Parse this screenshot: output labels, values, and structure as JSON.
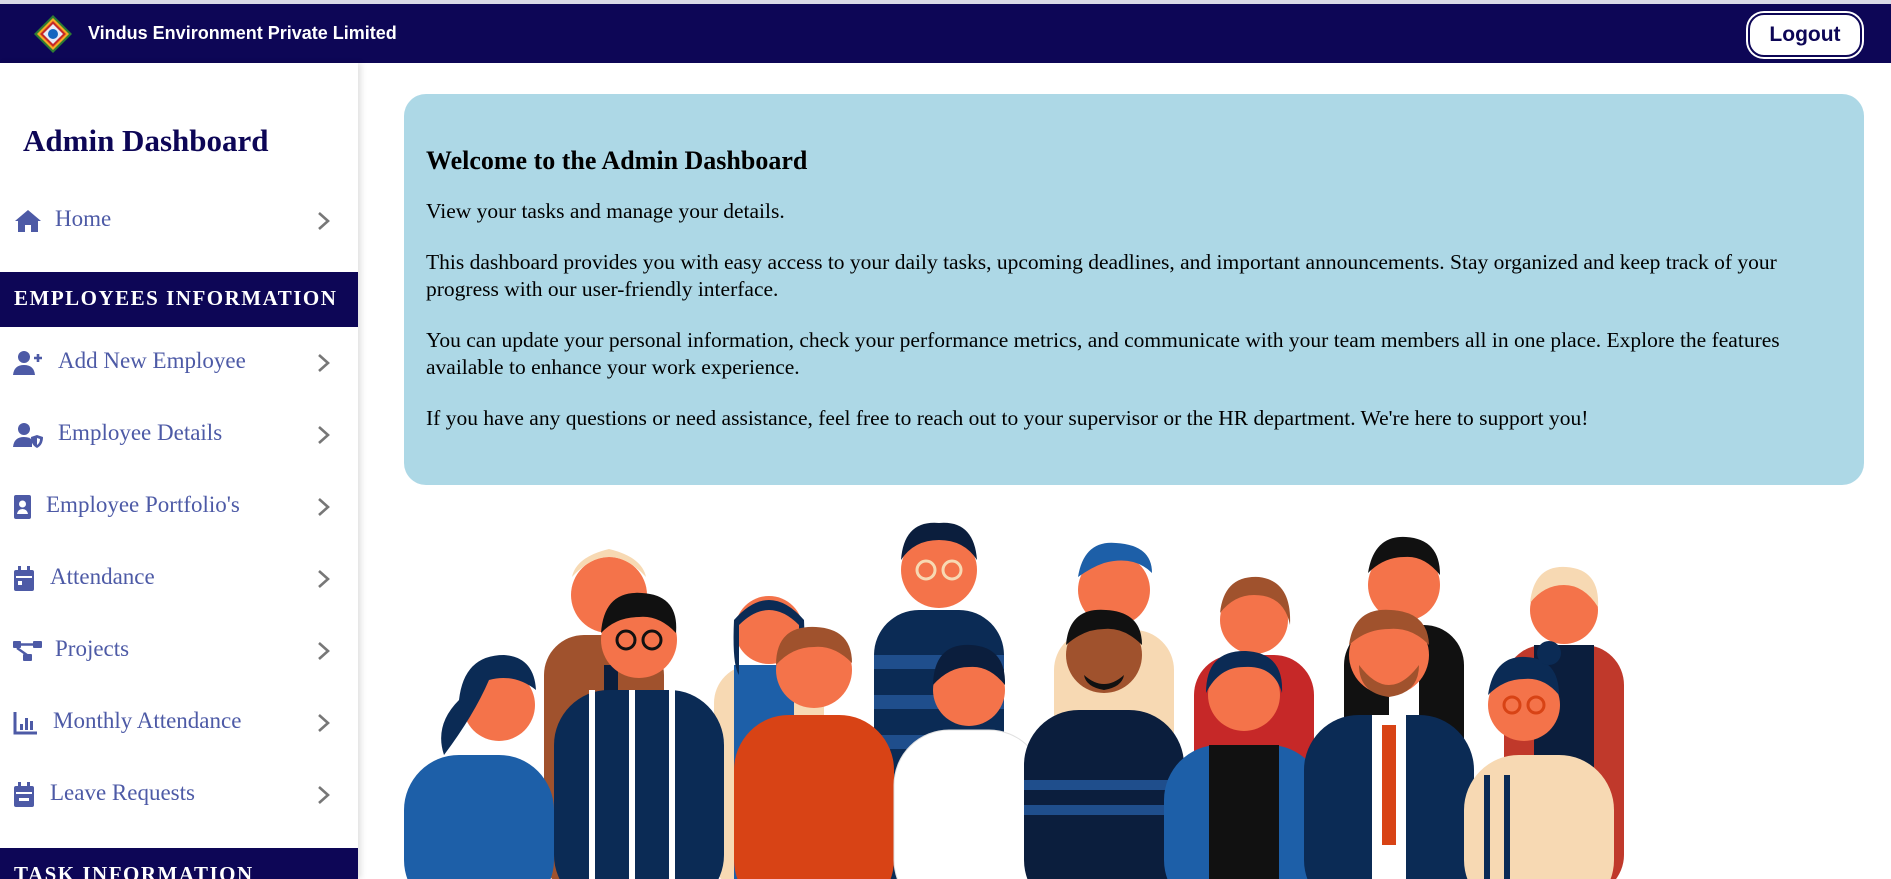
{
  "app": {
    "company_name": "Vindus Environment Private Limited",
    "logout_label": "Logout",
    "brand_color": "#0d0656",
    "accent_color": "#4d5aa6",
    "card_color": "#add8e6"
  },
  "sidebar": {
    "title": "Admin Dashboard",
    "home": {
      "label": "Home",
      "icon": "home-icon"
    },
    "sections": [
      {
        "title": "EMPLOYEES INFORMATION",
        "items": [
          {
            "label": "Add New Employee",
            "icon": "user-plus-icon"
          },
          {
            "label": "Employee Details",
            "icon": "user-shield-icon"
          },
          {
            "label": "Employee Portfolio's",
            "icon": "id-badge-icon"
          },
          {
            "label": "Attendance",
            "icon": "calendar-icon"
          },
          {
            "label": "Projects",
            "icon": "project-diagram-icon"
          },
          {
            "label": "Monthly Attendance",
            "icon": "bar-chart-icon"
          },
          {
            "label": "Leave Requests",
            "icon": "calendar-minus-icon"
          }
        ]
      },
      {
        "title": "TASK INFORMATION",
        "items": []
      }
    ]
  },
  "main": {
    "welcome_title": "Welcome to the Admin Dashboard",
    "paragraphs": [
      "View your tasks and manage your details.",
      "This dashboard provides you with easy access to your daily tasks, upcoming deadlines, and important announcements. Stay organized and keep track of your progress with our user-friendly interface.",
      "You can update your personal information, check your performance metrics, and communicate with your team members all in one place. Explore the features available to enhance your work experience.",
      "If you have any questions or need assistance, feel free to reach out to your supervisor or the HR department. We're here to support you!"
    ],
    "illustration": "team-people-illustration"
  }
}
